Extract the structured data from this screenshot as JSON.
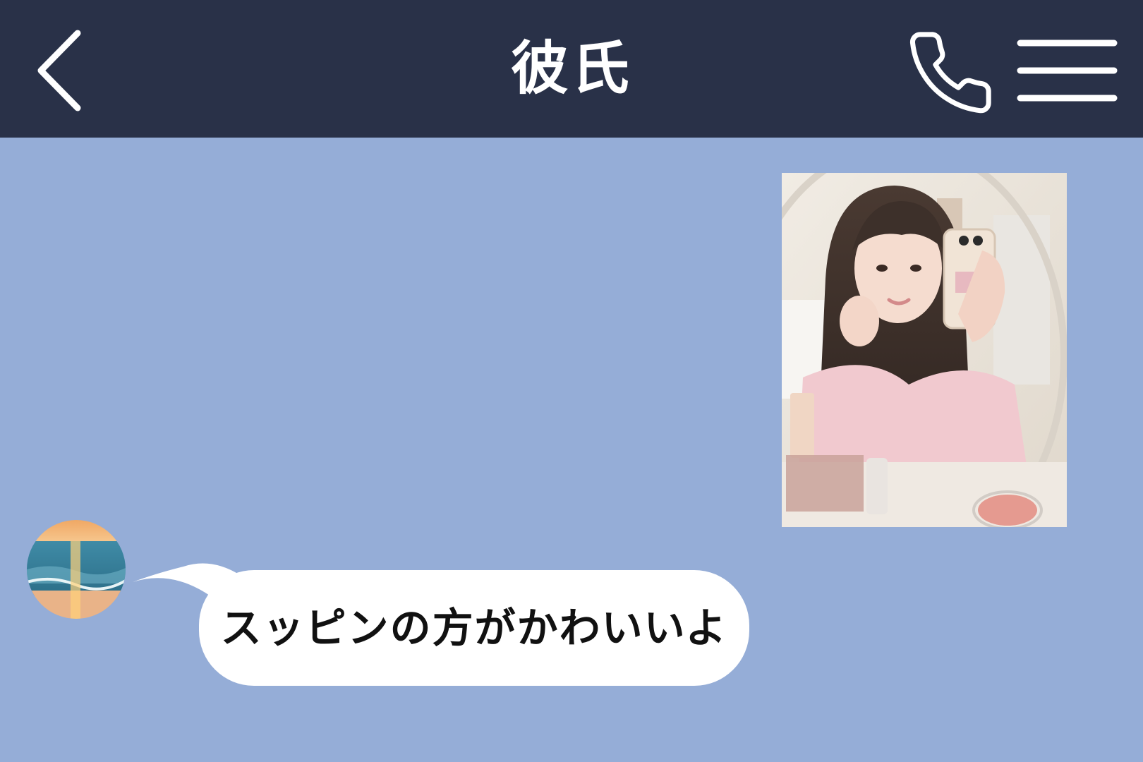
{
  "header": {
    "title": "彼氏",
    "back_icon": "chevron-left-icon",
    "call_icon": "phone-icon",
    "menu_icon": "hamburger-menu-icon"
  },
  "messages": [
    {
      "sender": "self",
      "type": "image"
    },
    {
      "sender": "partner",
      "type": "text",
      "avatar": "sunset-ocean-avatar",
      "text": "スッピンの方がかわいいよ"
    }
  ],
  "colors": {
    "header_bg": "#293148",
    "chat_bg": "#95add7",
    "bubble_bg": "#ffffff",
    "header_text": "#ffffff"
  }
}
